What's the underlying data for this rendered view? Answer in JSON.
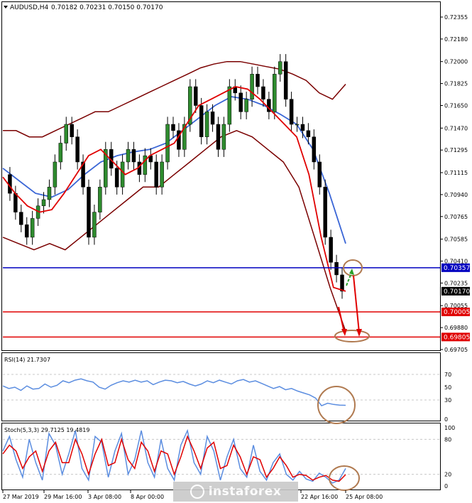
{
  "header": {
    "symbol": "AUDUSD,H4",
    "ohlc": "0.70182 0.70231 0.70150 0.70170"
  },
  "price_axis": {
    "ticks": [
      "0.72355",
      "0.72180",
      "0.72000",
      "0.71825",
      "0.71650",
      "0.71470",
      "0.71295",
      "0.71115",
      "0.70940",
      "0.70765",
      "0.70585",
      "0.70410",
      "0.70235",
      "0.70055",
      "0.69880",
      "0.69705"
    ],
    "tick_values": [
      0.72355,
      0.7218,
      0.72,
      0.71825,
      0.7165,
      0.7147,
      0.71295,
      0.71115,
      0.7094,
      0.70765,
      0.70585,
      0.7041,
      0.70235,
      0.70055,
      0.6988,
      0.69705
    ]
  },
  "levels": [
    {
      "label": "0.70357",
      "value": 0.70357,
      "color": "#0000c0",
      "kind": "line"
    },
    {
      "label": "0.70170",
      "value": 0.7017,
      "color": "#000000",
      "kind": "current"
    },
    {
      "label": "0.70005",
      "value": 0.70005,
      "color": "#e00000",
      "kind": "line"
    },
    {
      "label": "0.69805",
      "value": 0.69805,
      "color": "#e00000",
      "kind": "line"
    }
  ],
  "rsi": {
    "label": "RSI(14) 21.7307",
    "ticks": [
      "70",
      "50",
      "30",
      "0"
    ],
    "tick_values": [
      70,
      50,
      30,
      0
    ],
    "values": [
      52,
      48,
      50,
      45,
      52,
      47,
      48,
      55,
      50,
      53,
      60,
      57,
      61,
      63,
      60,
      58,
      50,
      47,
      53,
      57,
      60,
      58,
      61,
      58,
      60,
      54,
      58,
      61,
      60,
      57,
      59,
      55,
      52,
      55,
      60,
      57,
      61,
      58,
      55,
      60,
      62,
      58,
      60,
      56,
      52,
      48,
      51,
      46,
      48,
      44,
      41,
      38,
      33,
      21,
      25,
      23,
      22,
      21.7
    ]
  },
  "stoch": {
    "label": "Stoch(5,3,3) 29.7125 19.4819",
    "ticks": [
      "100",
      "80",
      "20",
      "0"
    ],
    "tick_values": [
      100,
      80,
      20,
      0
    ],
    "main": [
      60,
      85,
      45,
      15,
      80,
      40,
      10,
      90,
      70,
      20,
      55,
      95,
      30,
      10,
      85,
      75,
      15,
      60,
      90,
      20,
      45,
      95,
      40,
      15,
      80,
      30,
      10,
      70,
      95,
      40,
      20,
      85,
      60,
      10,
      50,
      80,
      30,
      15,
      70,
      25,
      10,
      40,
      55,
      20,
      10,
      25,
      12,
      8,
      22,
      15,
      5,
      10,
      30
    ],
    "signal": [
      55,
      70,
      60,
      30,
      50,
      60,
      25,
      60,
      75,
      40,
      40,
      80,
      55,
      20,
      55,
      80,
      35,
      40,
      80,
      45,
      30,
      75,
      60,
      25,
      60,
      55,
      20,
      50,
      85,
      60,
      30,
      65,
      75,
      30,
      35,
      70,
      50,
      20,
      50,
      45,
      15,
      30,
      50,
      35,
      15,
      20,
      18,
      10,
      15,
      18,
      10,
      8,
      19.5
    ]
  },
  "time_axis": {
    "labels": [
      "27 Mar 2019",
      "29 Mar 16:00",
      "3 Apr 08:00",
      "8 Apr 00:00",
      "",
      "",
      "",
      "22 Apr 16:00",
      "25 Apr 08:00"
    ]
  },
  "chart_data": {
    "type": "candlestick",
    "symbol": "AUDUSD,H4",
    "ylim": [
      0.69705,
      0.7245
    ],
    "close": [
      0.711,
      0.7095,
      0.708,
      0.707,
      0.706,
      0.7075,
      0.7085,
      0.709,
      0.71,
      0.712,
      0.7135,
      0.715,
      0.714,
      0.712,
      0.71,
      0.706,
      0.708,
      0.71,
      0.713,
      0.7115,
      0.71,
      0.712,
      0.713,
      0.712,
      0.711,
      0.7125,
      0.712,
      0.71,
      0.712,
      0.715,
      0.7145,
      0.713,
      0.715,
      0.718,
      0.7165,
      0.714,
      0.716,
      0.715,
      0.713,
      0.715,
      0.718,
      0.7175,
      0.716,
      0.717,
      0.719,
      0.718,
      0.717,
      0.716,
      0.719,
      0.72,
      0.717,
      0.715,
      0.715,
      0.7145,
      0.714,
      0.712,
      0.71,
      0.706,
      0.704,
      0.703,
      0.7017
    ],
    "bollinger_upper": [
      0.7145,
      0.7145,
      0.714,
      0.714,
      0.7145,
      0.715,
      0.7155,
      0.716,
      0.716,
      0.7165,
      0.717,
      0.7175,
      0.718,
      0.7185,
      0.719,
      0.7195,
      0.7198,
      0.72,
      0.72,
      0.7198,
      0.7196,
      0.7194,
      0.719,
      0.7185,
      0.7175,
      0.717,
      0.7182
    ],
    "bollinger_lower": [
      0.706,
      0.7055,
      0.705,
      0.7055,
      0.705,
      0.706,
      0.707,
      0.708,
      0.709,
      0.71,
      0.71,
      0.711,
      0.712,
      0.713,
      0.714,
      0.7145,
      0.714,
      0.713,
      0.712,
      0.71,
      0.706,
      0.702,
      0.6985
    ],
    "moving_average_fast": [
      0.7108,
      0.7095,
      0.7085,
      0.708,
      0.7082,
      0.7095,
      0.711,
      0.7125,
      0.713,
      0.712,
      0.711,
      0.7115,
      0.7125,
      0.713,
      0.7135,
      0.715,
      0.7165,
      0.717,
      0.7175,
      0.718,
      0.7178,
      0.717,
      0.716,
      0.715,
      0.714,
      0.711,
      0.706,
      0.702,
      0.7017
    ],
    "moving_average_slow": [
      0.7115,
      0.7105,
      0.7095,
      0.7092,
      0.7098,
      0.711,
      0.712,
      0.7125,
      0.7128,
      0.713,
      0.7135,
      0.7145,
      0.7155,
      0.7165,
      0.7172,
      0.717,
      0.7165,
      0.7158,
      0.715,
      0.713,
      0.7095,
      0.7055
    ]
  }
}
